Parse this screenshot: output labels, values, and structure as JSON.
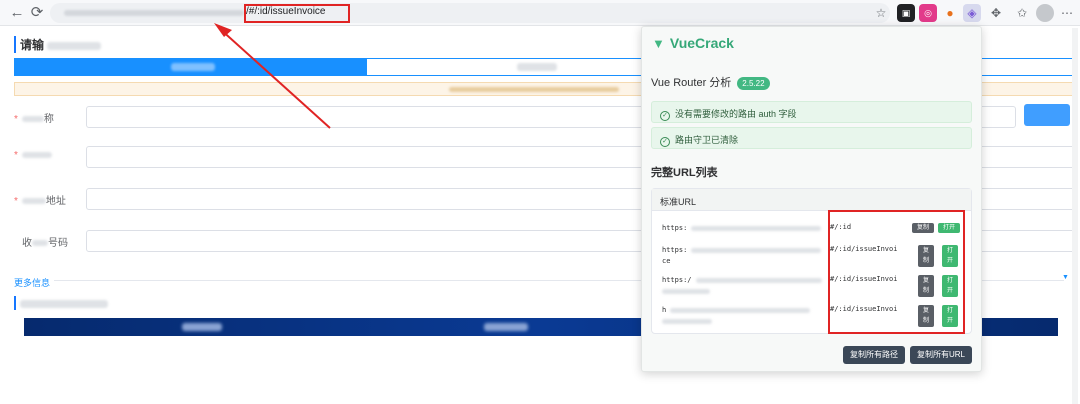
{
  "browser": {
    "url_visible_suffix": "/#/:id/issueInvoice",
    "back_icon": "arrow-left",
    "reload_icon": "reload"
  },
  "page": {
    "section1_title": "请输",
    "form": {
      "name_label_suffix": "称",
      "address_label_suffix": "地址",
      "number_label_prefix": "收",
      "number_label_suffix": "号码"
    },
    "more_info": "更多信息"
  },
  "panel": {
    "brand": "VueCrack",
    "router_title": "Vue Router 分析",
    "version": "2.5.22",
    "status": [
      "没有需要修改的路由 auth 字段",
      "路由守卫已清除"
    ],
    "url_list_title": "完整URL列表",
    "card_head": "标准URL",
    "rows": [
      {
        "prefix": "https:",
        "path": "#/:id",
        "copy": "复制",
        "open": "打开"
      },
      {
        "prefix": "https:",
        "tail": "ce",
        "path": "#/:id/issueInvoi",
        "copy": "复\n制",
        "open": "打\n开"
      },
      {
        "prefix": "https:/",
        "path": "#/:id/issueInvoi",
        "copy": "复\n制",
        "open": "打\n开"
      },
      {
        "prefix": "h",
        "path": "#/:id/issueInvoi",
        "copy": "复\n制",
        "open": "打\n开"
      }
    ],
    "copy_all_paths": "复制所有路径",
    "copy_all_urls": "复制所有URL"
  },
  "colors": {
    "accent_blue": "#1890ff",
    "vue_green": "#42b883",
    "annotation_red": "#e02424",
    "dark_button": "#3b4858"
  }
}
